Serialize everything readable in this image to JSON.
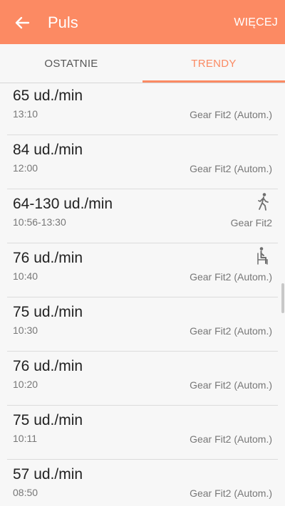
{
  "appbar": {
    "title": "Puls",
    "more_label": "WIĘCEJ",
    "back_icon": "arrow-left-icon",
    "background": "#fc8a63"
  },
  "tabs": [
    {
      "label": "OSTATNIE",
      "selected": false
    },
    {
      "label": "TRENDY",
      "selected": true
    }
  ],
  "accent_color": "#fb8a63",
  "readings": [
    {
      "value": "65 ud./min",
      "time": "13:10",
      "source": "Gear Fit2 (Autom.)",
      "icon": ""
    },
    {
      "value": "84 ud./min",
      "time": "12:00",
      "source": "Gear Fit2 (Autom.)",
      "icon": ""
    },
    {
      "value": "64-130 ud./min",
      "time": "10:56-13:30",
      "source": "Gear Fit2",
      "icon": "walking-icon"
    },
    {
      "value": "76 ud./min",
      "time": "10:40",
      "source": "Gear Fit2 (Autom.)",
      "icon": "sitting-icon"
    },
    {
      "value": "75 ud./min",
      "time": "10:30",
      "source": "Gear Fit2 (Autom.)",
      "icon": ""
    },
    {
      "value": "76 ud./min",
      "time": "10:20",
      "source": "Gear Fit2 (Autom.)",
      "icon": ""
    },
    {
      "value": "75 ud./min",
      "time": "10:11",
      "source": "Gear Fit2 (Autom.)",
      "icon": ""
    },
    {
      "value": "57 ud./min",
      "time": "08:50",
      "source": "Gear Fit2 (Autom.)",
      "icon": ""
    }
  ]
}
